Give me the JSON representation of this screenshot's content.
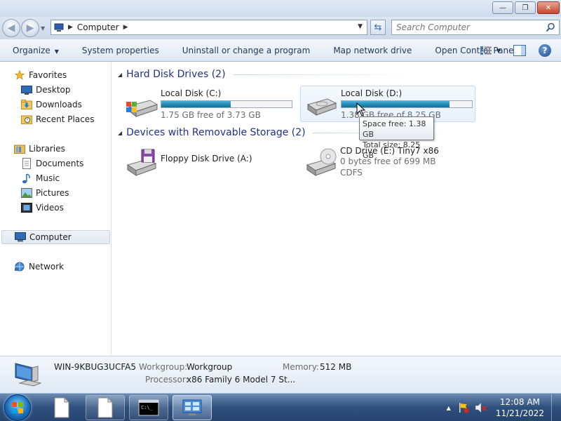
{
  "window": {
    "controls": {
      "minimize": "—",
      "maximize": "❐",
      "close": "✕"
    }
  },
  "address": {
    "breadcrumb": "Computer",
    "search_placeholder": "Search Computer"
  },
  "toolbar": {
    "organize": "Organize",
    "system_properties": "System properties",
    "uninstall": "Uninstall or change a program",
    "map_drive": "Map network drive",
    "control_panel": "Open Control Panel",
    "help": "?"
  },
  "nav": {
    "favorites": "Favorites",
    "desktop": "Desktop",
    "downloads": "Downloads",
    "recent_places": "Recent Places",
    "libraries": "Libraries",
    "documents": "Documents",
    "music": "Music",
    "pictures": "Pictures",
    "videos": "Videos",
    "computer": "Computer",
    "network": "Network"
  },
  "groups": {
    "hard_disks": "Hard Disk Drives (2)",
    "removable": "Devices with Removable Storage (2)"
  },
  "drives": {
    "c": {
      "name": "Local Disk (C:)",
      "free_text": "1.75 GB free of 3.73 GB",
      "used_fraction": 0.53
    },
    "d": {
      "name": "Local Disk (D:)",
      "free_text": "1.38 GB free of 8.25 GB",
      "used_fraction": 0.83
    },
    "a": {
      "name": "Floppy Disk Drive (A:)"
    },
    "e": {
      "name": "CD Drive (E:) Tiny7 x86",
      "free_text": "0 bytes free of 699 MB",
      "fs": "CDFS"
    }
  },
  "tooltip": {
    "space_free": "Space free: 1.38 GB",
    "total_size": "Total size: 8.25 GB"
  },
  "details": {
    "computer_name": "WIN-9KBUG3UCFA5",
    "workgroup_label": "Workgroup:",
    "workgroup_value": "Workgroup",
    "memory_label": "Memory:",
    "memory_value": "512 MB",
    "processor_label": "Processor:",
    "processor_value": "x86 Family 6 Model 7 St..."
  },
  "taskbar": {
    "time": "12:08 AM",
    "date": "11/21/2022",
    "show_hidden": "▲"
  }
}
